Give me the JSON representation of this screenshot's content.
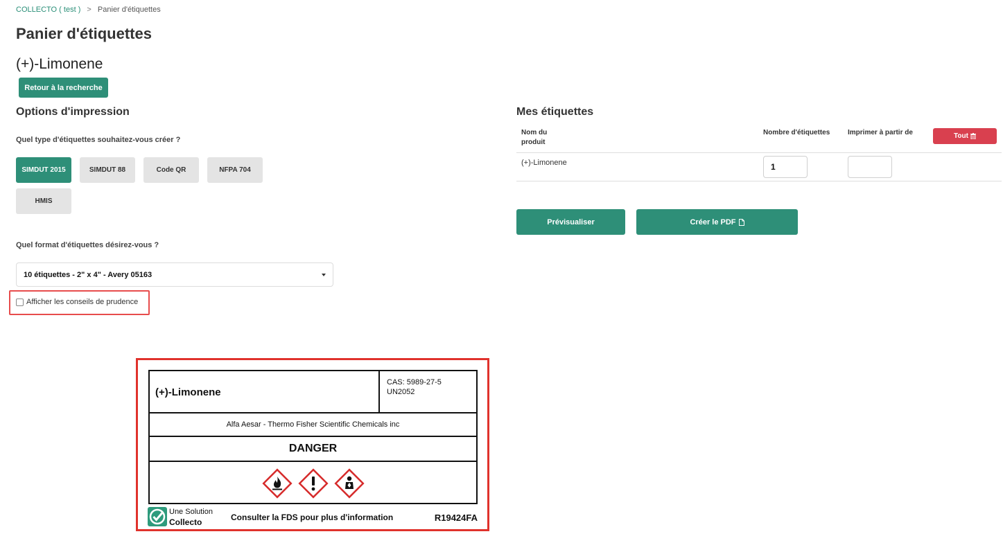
{
  "breadcrumb": {
    "root": "COLLECTO",
    "paren_open": "(",
    "org": "test",
    "paren_close": ")",
    "separator": ">",
    "current": "Panier d'étiquettes"
  },
  "page": {
    "title": "Panier d'étiquettes",
    "product": "(+)-Limonene",
    "back_label": "Retour à la recherche"
  },
  "options": {
    "title": "Options d'impression",
    "type_question": "Quel type d'étiquettes souhaitez-vous créer ?",
    "types": [
      {
        "label": "SIMDUT 2015",
        "active": true
      },
      {
        "label": "SIMDUT 88",
        "active": false
      },
      {
        "label": "Code QR",
        "active": false
      },
      {
        "label": "NFPA 704",
        "active": false
      },
      {
        "label": "HMIS",
        "active": false
      }
    ],
    "format_question": "Quel format d'étiquettes désirez-vous ?",
    "format_value": "10 étiquettes - 2\" x 4\" - Avery 05163",
    "prudence_label": "Afficher les conseils de prudence"
  },
  "labels": {
    "title": "Mes étiquettes",
    "col_name_1": "Nom du",
    "col_name_2": "produit",
    "col_count": "Nombre d'étiquettes",
    "col_start": "Imprimer à partir de",
    "clear_label": "Tout",
    "rows": [
      {
        "name": "(+)-Limonene",
        "count": "1",
        "start": ""
      }
    ],
    "preview_label": "Prévisualiser",
    "pdf_label": "Créer le PDF"
  },
  "label_preview": {
    "name": "(+)-Limonene",
    "cas": "CAS: 5989-27-5",
    "un": "UN2052",
    "supplier": "Alfa Aesar - Thermo Fisher Scientific Chemicals inc",
    "signal": "DANGER",
    "pictograms": [
      "flame-icon",
      "exclamation-icon",
      "health-hazard-icon"
    ],
    "brand_line1": "Une Solution",
    "brand_line2": "Collecto",
    "consult": "Consulter la FDS pour plus d'information",
    "reference": "R19424FA"
  },
  "colors": {
    "accent": "#2e8f78",
    "danger": "#d9404f",
    "highlight": "#e0322c"
  }
}
